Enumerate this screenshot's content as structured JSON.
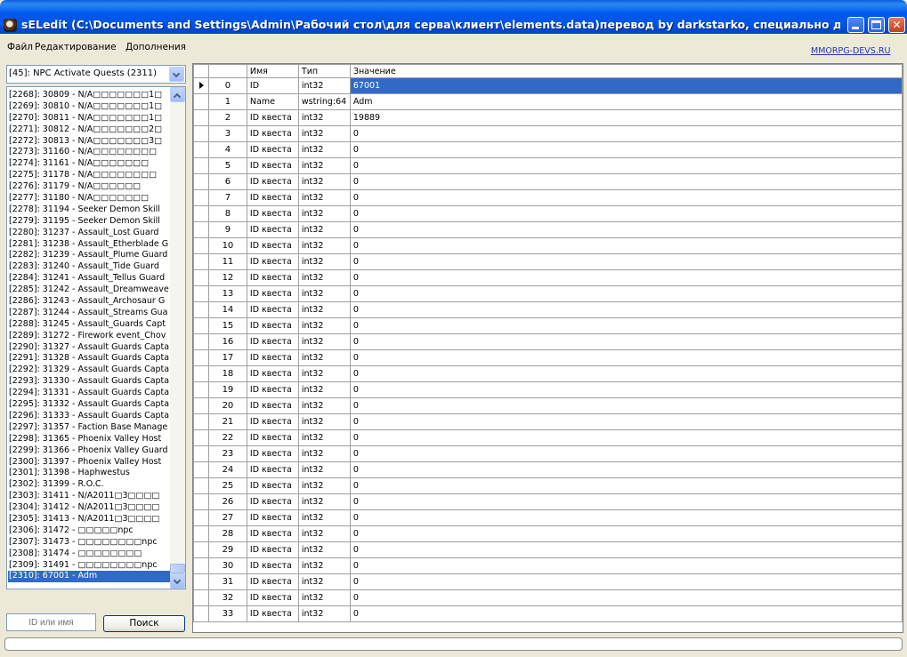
{
  "window": {
    "title": "sELedit (C:\\Documents and Settings\\Admin\\Рабочий стол\\для серва\\клиент\\elements.data)перевод by darkstarko, специально для mmorpg-de...",
    "icon": "app-icon"
  },
  "menu": {
    "file": "Файл",
    "edit": "Редактирование",
    "addons": "Дополнения",
    "link": "MMORPG-DEVS.RU",
    "link_color": "#2039a8"
  },
  "left": {
    "combo_value": "[45]: NPC Activate Quests (2311)",
    "items": [
      "[2268]: 30809 - N/A□□□□□□□1□",
      "[2269]: 30810 - N/A□□□□□□□1□",
      "[2270]: 30811 - N/A□□□□□□□1□",
      "[2271]: 30812 - N/A□□□□□□□2□",
      "[2272]: 30813 - N/A□□□□□□□3□",
      "[2273]: 31160 - N/A□□□□□□□□",
      "[2274]: 31161 - N/A□□□□□□□",
      "[2275]: 31178 - N/A□□□□□□□□",
      "[2276]: 31179 - N/A□□□□□□",
      "[2277]: 31180 - N/A□□□□□□□",
      "[2278]: 31194 - Seeker Demon Skill",
      "[2279]: 31195 - Seeker Demon Skill",
      "[2280]: 31237 - Assault_Lost Guard",
      "[2281]: 31238 - Assault_Etherblade G",
      "[2282]: 31239 - Assault_Plume Guard",
      "[2283]: 31240 - Assault_Tide Guard",
      "[2284]: 31241 - Assault_Tellus Guard",
      "[2285]: 31242 - Assault_Dreamweave",
      "[2286]: 31243 - Assault_Archosaur G",
      "[2287]: 31244 - Assault_Streams Gua",
      "[2288]: 31245 - Assault_Guards Capt",
      "[2289]: 31272 - Firework event_Chov",
      "[2290]: 31327 - Assault Guards Capta",
      "[2291]: 31328 - Assault Guards Capta",
      "[2292]: 31329 - Assault Guards Capta",
      "[2293]: 31330 - Assault Guards Capta",
      "[2294]: 31331 - Assault Guards Capta",
      "[2295]: 31332 - Assault Guards Capta",
      "[2296]: 31333 - Assault Guards Capta",
      "[2297]: 31357 - Faction Base Manage",
      "[2298]: 31365 - Phoenix Valley Host",
      "[2299]: 31366 - Phoenix Valley Guard",
      "[2300]: 31397 - Phoenix Valley Host",
      "[2301]: 31398 - Haphwestus",
      "[2302]: 31399 - R.O.C.",
      "[2303]: 31411 - N/A2011□3□□□□",
      "[2304]: 31412 - N/A2011□3□□□□",
      "[2305]: 31413 - N/A2011□3□□□□",
      "[2306]: 31472 - □□□□□npc",
      "[2307]: 31473 - □□□□□□□□npc",
      "[2308]: 31474 - □□□□□□□□",
      "[2309]: 31491 - □□□□□□□□npc",
      "[2310]: 67001 - Adm"
    ],
    "selected_index": 42,
    "search_placeholder": "ID или имя",
    "search_button": "Поиск"
  },
  "grid": {
    "headers": [
      "Имя",
      "Тип",
      "Значение"
    ],
    "selected_row": 0,
    "rows": [
      [
        "0",
        "ID",
        "int32",
        "67001"
      ],
      [
        "1",
        "Name",
        "wstring:64",
        "Adm"
      ],
      [
        "2",
        "ID квеста",
        "int32",
        "19889"
      ],
      [
        "3",
        "ID квеста",
        "int32",
        "0"
      ],
      [
        "4",
        "ID квеста",
        "int32",
        "0"
      ],
      [
        "5",
        "ID квеста",
        "int32",
        "0"
      ],
      [
        "6",
        "ID квеста",
        "int32",
        "0"
      ],
      [
        "7",
        "ID квеста",
        "int32",
        "0"
      ],
      [
        "8",
        "ID квеста",
        "int32",
        "0"
      ],
      [
        "9",
        "ID квеста",
        "int32",
        "0"
      ],
      [
        "10",
        "ID квеста",
        "int32",
        "0"
      ],
      [
        "11",
        "ID квеста",
        "int32",
        "0"
      ],
      [
        "12",
        "ID квеста",
        "int32",
        "0"
      ],
      [
        "13",
        "ID квеста",
        "int32",
        "0"
      ],
      [
        "14",
        "ID квеста",
        "int32",
        "0"
      ],
      [
        "15",
        "ID квеста",
        "int32",
        "0"
      ],
      [
        "16",
        "ID квеста",
        "int32",
        "0"
      ],
      [
        "17",
        "ID квеста",
        "int32",
        "0"
      ],
      [
        "18",
        "ID квеста",
        "int32",
        "0"
      ],
      [
        "19",
        "ID квеста",
        "int32",
        "0"
      ],
      [
        "20",
        "ID квеста",
        "int32",
        "0"
      ],
      [
        "21",
        "ID квеста",
        "int32",
        "0"
      ],
      [
        "22",
        "ID квеста",
        "int32",
        "0"
      ],
      [
        "23",
        "ID квеста",
        "int32",
        "0"
      ],
      [
        "24",
        "ID квеста",
        "int32",
        "0"
      ],
      [
        "25",
        "ID квеста",
        "int32",
        "0"
      ],
      [
        "26",
        "ID квеста",
        "int32",
        "0"
      ],
      [
        "27",
        "ID квеста",
        "int32",
        "0"
      ],
      [
        "28",
        "ID квеста",
        "int32",
        "0"
      ],
      [
        "29",
        "ID квеста",
        "int32",
        "0"
      ],
      [
        "30",
        "ID квеста",
        "int32",
        "0"
      ],
      [
        "31",
        "ID квеста",
        "int32",
        "0"
      ],
      [
        "32",
        "ID квеста",
        "int32",
        "0"
      ],
      [
        "33",
        "ID квеста",
        "int32",
        "0"
      ]
    ]
  },
  "colors": {
    "selection": "#316ac5",
    "titlebar": "#0055e5",
    "window_bg": "#ece9d8"
  }
}
